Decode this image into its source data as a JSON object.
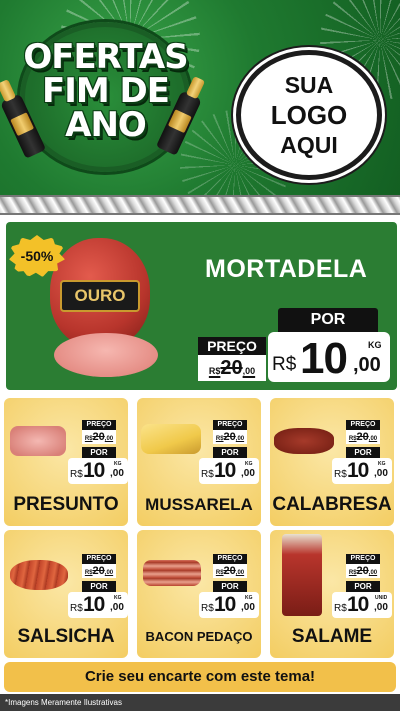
{
  "header": {
    "title_lines": [
      "OFERTAS",
      "FIM DE",
      "ANO"
    ],
    "logo_lines": [
      "SUA",
      "LOGO",
      "AQUI"
    ]
  },
  "featured": {
    "discount": "-50%",
    "brand_label": "OURO",
    "name": "MORTADELA",
    "old_label": "PREÇO",
    "old_price_int": "20",
    "old_price_dec": ",00",
    "old_currency": "R$",
    "new_label": "POR",
    "currency": "R$",
    "price_int": "10",
    "price_dec": ",00",
    "unit": "KG"
  },
  "products": [
    {
      "name": "PRESUNTO",
      "old_label": "PREÇO",
      "old_currency": "R$",
      "old_int": "20",
      "old_dec": ",00",
      "new_label": "POR",
      "currency": "R$",
      "int": "10",
      "dec": ",00",
      "unit": "KG"
    },
    {
      "name": "MUSSARELA",
      "old_label": "PREÇO",
      "old_currency": "R$",
      "old_int": "20",
      "old_dec": ",00",
      "new_label": "POR",
      "currency": "R$",
      "int": "10",
      "dec": ",00",
      "unit": "KG"
    },
    {
      "name": "CALABRESA",
      "old_label": "PREÇO",
      "old_currency": "R$",
      "old_int": "20",
      "old_dec": ",00",
      "new_label": "POR",
      "currency": "R$",
      "int": "10",
      "dec": ",00",
      "unit": "KG"
    },
    {
      "name": "SALSICHA",
      "old_label": "PREÇO",
      "old_currency": "R$",
      "old_int": "20",
      "old_dec": ",00",
      "new_label": "POR",
      "currency": "R$",
      "int": "10",
      "dec": ",00",
      "unit": "KG"
    },
    {
      "name": "BACON PEDAÇO",
      "old_label": "PREÇO",
      "old_currency": "R$",
      "old_int": "20",
      "old_dec": ",00",
      "new_label": "POR",
      "currency": "R$",
      "int": "10",
      "dec": ",00",
      "unit": "KG"
    },
    {
      "name": "SALAME",
      "old_label": "PREÇO",
      "old_currency": "R$",
      "old_int": "20",
      "old_dec": ",00",
      "new_label": "POR",
      "currency": "R$",
      "int": "10",
      "dec": ",00",
      "unit": "UNID"
    }
  ],
  "cta": "Crie seu encarte com este tema!",
  "disclaimer": "*Imagens Meramente Ilustrativas",
  "colors": {
    "header_green": "#1f7a30",
    "card_yellow": "#f3cd62",
    "cta_yellow": "#f2c04a"
  }
}
